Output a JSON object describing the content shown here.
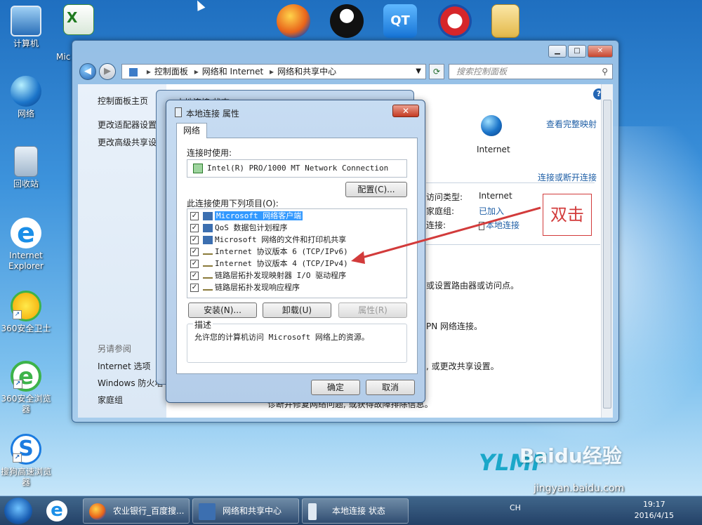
{
  "desktop": {
    "icons": [
      {
        "label": "计算机"
      },
      {
        "label": "网络"
      },
      {
        "label": "回收站"
      },
      {
        "label": "Internet\nExplorer"
      },
      {
        "label": "360安全卫士"
      },
      {
        "label": "360安全浏览\n器"
      },
      {
        "label": "搜狗高速浏览\n器"
      }
    ],
    "partial_icon_label": "Mic"
  },
  "explorer": {
    "breadcrumb": [
      "控制面板",
      "网络和 Internet",
      "网络和共享中心"
    ],
    "search_placeholder": "搜索控制面板",
    "left_links": [
      "控制面板主页",
      "更改适配器设置",
      "更改高级共享设"
    ],
    "see_also_header": "另请参阅",
    "see_also_links": [
      "Internet 选项",
      "Windows 防火墙",
      "家庭组"
    ],
    "right": {
      "view_full_map": "查看完整映射",
      "internet_label": "Internet",
      "connect_disconnect": "连接或断开连接",
      "access_type_label": "访问类型:",
      "access_type_value": "Internet",
      "homegroup_label": "家庭组:",
      "homegroup_value": "已加入",
      "connection_label": "连接:",
      "connection_value": "本地连接",
      "text1": "或设置路由器或访问点。",
      "text2": "PN 网络连接。",
      "text3": ", 或更改共享设置。",
      "text4": "诊断并修复网络问题, 或获得故障排除信息。"
    }
  },
  "status_dialog": {
    "title": "本地连接 状态"
  },
  "properties_dialog": {
    "title": "本地连接 属性",
    "tab": "网络",
    "connect_using_label": "连接时使用:",
    "adapter": "Intel(R) PRO/1000 MT Network Connection",
    "configure_button": "配置(C)...",
    "items_label": "此连接使用下列项目(O):",
    "items": [
      {
        "text": "Microsoft 网络客户端",
        "checked": true,
        "selected": true
      },
      {
        "text": "QoS 数据包计划程序",
        "checked": true,
        "selected": false
      },
      {
        "text": "Microsoft 网络的文件和打印机共享",
        "checked": true,
        "selected": false
      },
      {
        "text": "Internet 协议版本 6 (TCP/IPv6)",
        "checked": true,
        "selected": false
      },
      {
        "text": "Internet 协议版本 4 (TCP/IPv4)",
        "checked": true,
        "selected": false
      },
      {
        "text": "链路层拓扑发现映射器 I/O 驱动程序",
        "checked": true,
        "selected": false
      },
      {
        "text": "链路层拓扑发现响应程序",
        "checked": true,
        "selected": false
      }
    ],
    "install_button": "安装(N)...",
    "uninstall_button": "卸载(U)",
    "properties_button": "属性(R)",
    "description_caption": "描述",
    "description_text": "允许您的计算机访问 Microsoft 网络上的资源。",
    "ok_button": "确定",
    "cancel_button": "取消"
  },
  "annotation": {
    "text": "双击",
    "color": "#d23b3b"
  },
  "taskbar": {
    "buttons": [
      "农业银行_百度搜...",
      "网络和共享中心",
      "本地连接 状态"
    ],
    "lang": "CH",
    "time": "19:17",
    "date": "2016/4/15"
  },
  "watermark": {
    "brand": "Baidu经验",
    "url": "jingyan.baidu.com",
    "logo": "YLMF"
  }
}
